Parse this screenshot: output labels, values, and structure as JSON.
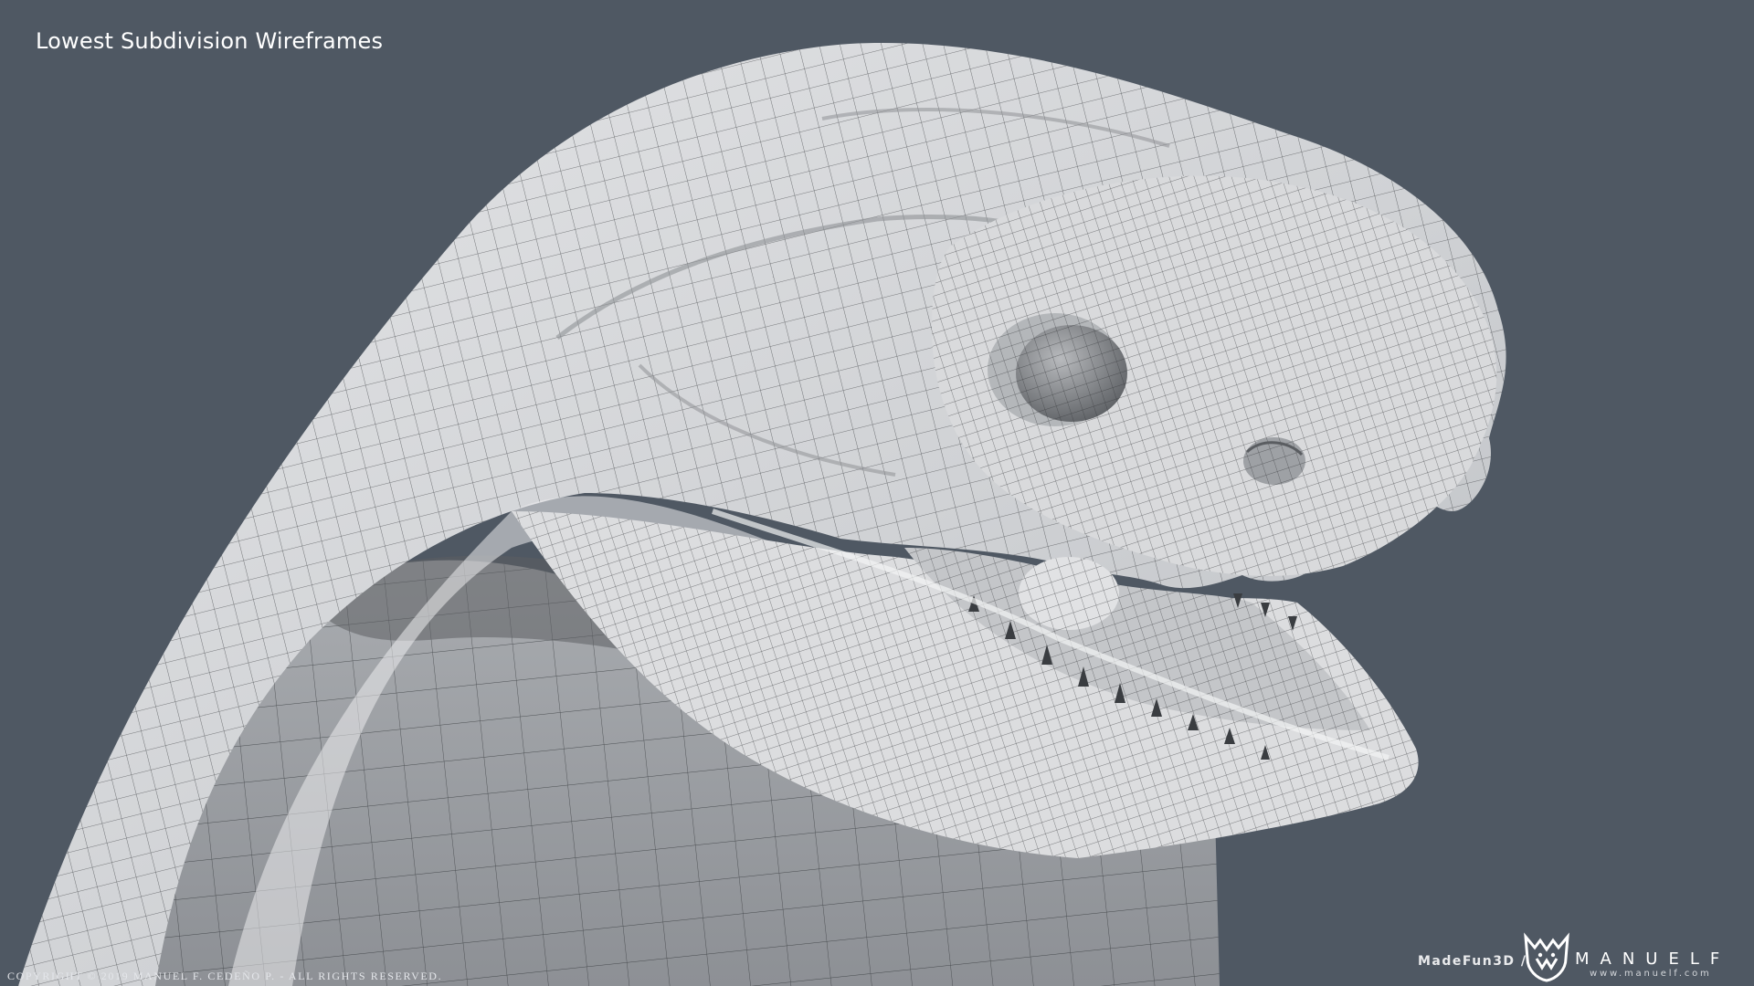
{
  "scene": {
    "title": "Lowest Subdivision Wireframes",
    "subject": "creature-head-wireframe",
    "background_color": "#4f5863",
    "mesh_color": "#cfd1d4",
    "wire_color": "#2e3134"
  },
  "footer": {
    "copyright": "COPYRIGHT © 2019 MANUEL F. CEDEÑO P. - ALL RIGHTS RESERVED.",
    "studio": "MadeFun3D /",
    "brand_name": "MANUELF",
    "brand_url": "www.manuelf.com",
    "logo_icon": "manuelf-mask-logo-icon"
  }
}
